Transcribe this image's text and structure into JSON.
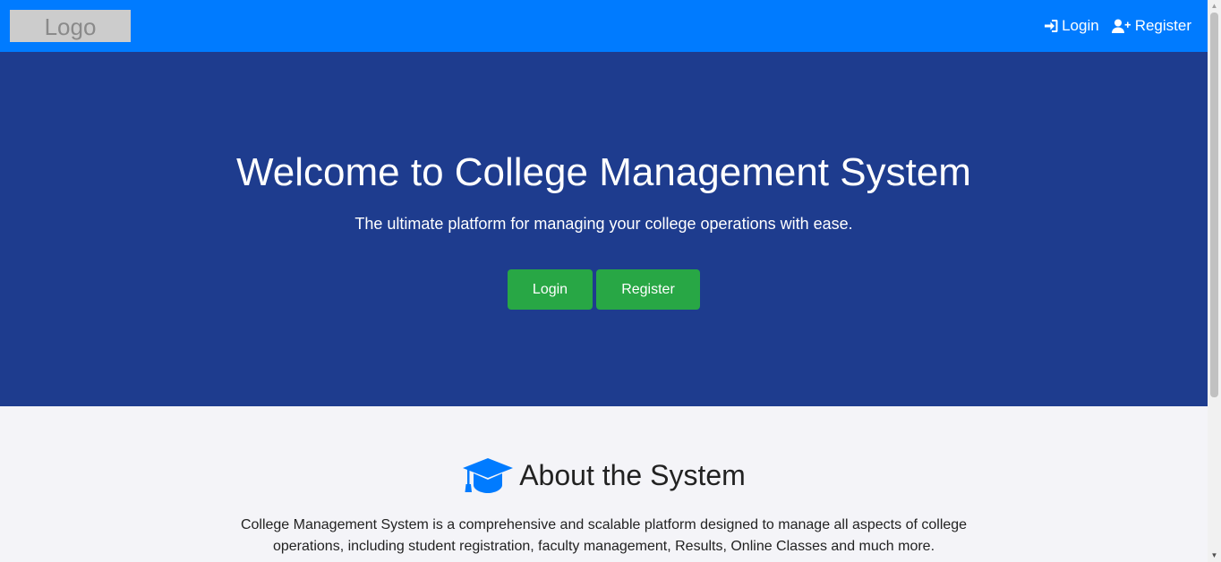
{
  "navbar": {
    "logo_text": "Logo",
    "links": [
      {
        "label": "Login",
        "icon": "sign-in-icon"
      },
      {
        "label": "Register",
        "icon": "user-plus-icon"
      }
    ]
  },
  "hero": {
    "title": "Welcome to College Management System",
    "subtitle": "The ultimate platform for managing your college operations with ease.",
    "login_button": "Login",
    "register_button": "Register"
  },
  "about": {
    "icon": "graduation-cap-icon",
    "title": "About the System",
    "text": "College Management System is a comprehensive and scalable platform designed to manage all aspects of college operations, including student registration, faculty management, Results, Online Classes and much more."
  },
  "colors": {
    "navbar": "#007bff",
    "hero": "#1e3c8e",
    "button": "#28a745",
    "about_bg": "#f4f4f8"
  }
}
